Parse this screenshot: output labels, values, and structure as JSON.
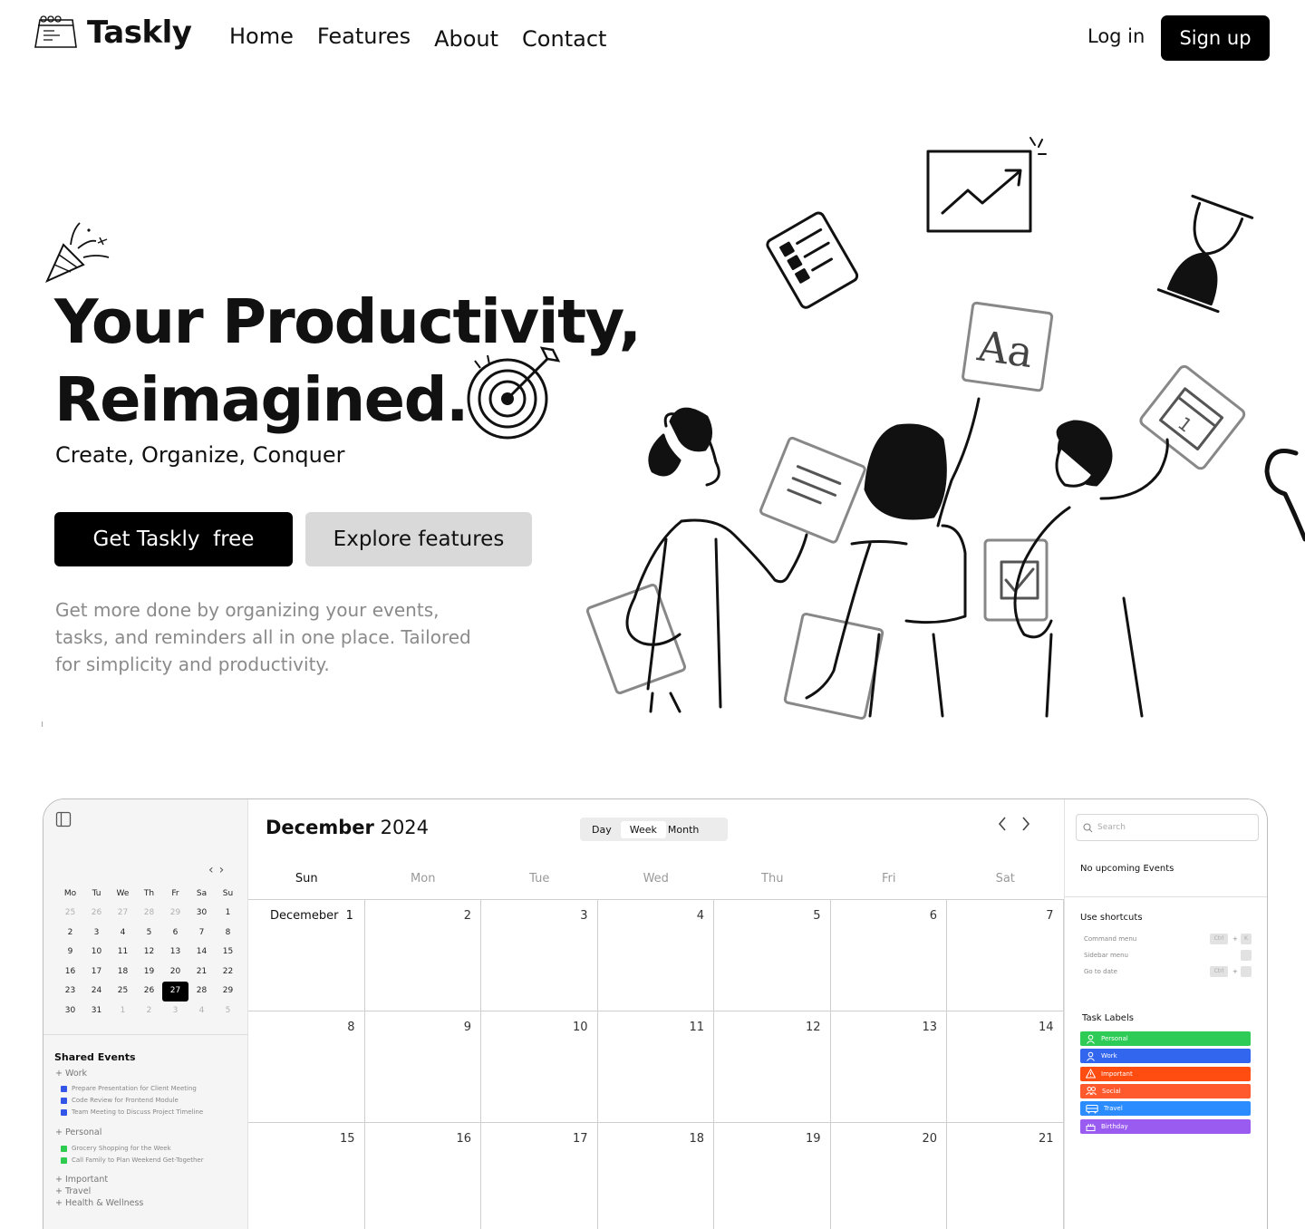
{
  "nav": {
    "brand": "Taskly",
    "links": [
      "Home",
      "Features",
      "About",
      "Contact"
    ],
    "login": "Log in",
    "signup": "Sign up"
  },
  "hero": {
    "title_line1": "Your Productivity,",
    "title_line2": "Reimagined.",
    "subtitle": "Create, Organize, Conquer",
    "primary_cta": "Get Taskly  free",
    "secondary_cta": "Explore features",
    "description": "Get more done by organizing your events, tasks, and reminders all in one place. Tailored for simplicity and productivity."
  },
  "illustration": {
    "card_text": "Aa",
    "calendar_day": "1"
  },
  "preview": {
    "mini_calendar": {
      "nav_prev": "‹",
      "nav_next": "›",
      "headers": [
        "Mo",
        "Tu",
        "We",
        "Th",
        "Fr",
        "Sa",
        "Su"
      ],
      "weeks": [
        [
          "25",
          "26",
          "27",
          "28",
          "29",
          "30",
          "1"
        ],
        [
          "2",
          "3",
          "4",
          "5",
          "6",
          "7",
          "8"
        ],
        [
          "9",
          "10",
          "11",
          "12",
          "13",
          "14",
          "15"
        ],
        [
          "16",
          "17",
          "18",
          "19",
          "20",
          "21",
          "22"
        ],
        [
          "23",
          "24",
          "25",
          "26",
          "27",
          "28",
          "29"
        ],
        [
          "30",
          "31",
          "1",
          "2",
          "3",
          "4",
          "5"
        ]
      ],
      "selected": "27"
    },
    "shared_events": {
      "title": "Shared Events",
      "work_group": "+ Work",
      "work_items": [
        "Prepare Presentation for Client Meeting",
        "Code Review for Frontend Module",
        "Team Meeting to Discuss Project Timeline"
      ],
      "personal_group": "+ Personal",
      "personal_items": [
        "Grocery Shopping for the Week",
        "Call Family to Plan Weekend Get-Together"
      ],
      "other_groups": [
        "+ Important",
        "+ Travel",
        "+ Health & Wellness"
      ],
      "colors": {
        "work": "#3356e8",
        "personal": "#2ecc4e"
      }
    },
    "calendar": {
      "month": "December",
      "year": "2024",
      "views": [
        "Day",
        "Week",
        "Month"
      ],
      "active_view": "Week",
      "weekdays": [
        "Sun",
        "Mon",
        "Tue",
        "Wed",
        "Thu",
        "Fri",
        "Sat"
      ],
      "rows": [
        [
          "Decemeber  1",
          "2",
          "3",
          "4",
          "5",
          "6",
          "7"
        ],
        [
          "8",
          "9",
          "10",
          "11",
          "12",
          "13",
          "14"
        ],
        [
          "15",
          "16",
          "17",
          "18",
          "19",
          "20",
          "21"
        ]
      ]
    },
    "right": {
      "search_placeholder": "Search",
      "no_events": "No upcoming Events",
      "shortcuts_title": "Use shortcuts",
      "shortcuts": [
        {
          "label": "Command menu",
          "keys": [
            "Ctrl",
            "+",
            "K"
          ]
        },
        {
          "label": "Sidebar menu",
          "keys": [
            ""
          ]
        },
        {
          "label": "Go to date",
          "keys": [
            "Ctrl",
            "+",
            ""
          ]
        }
      ],
      "labels_title": "Task Labels",
      "labels": [
        {
          "name": "Personal",
          "color": "#2ecc56",
          "icon": "user-icon"
        },
        {
          "name": "Work",
          "color": "#3366ee",
          "icon": "user-icon"
        },
        {
          "name": "Important",
          "color": "#ff4d12",
          "icon": "warning-icon"
        },
        {
          "name": "Social",
          "color": "#ff5a2e",
          "icon": "users-icon"
        },
        {
          "name": "Travel",
          "color": "#2b8cff",
          "icon": "bus-icon"
        },
        {
          "name": "Birthday",
          "color": "#9a5bf0",
          "icon": "cake-icon"
        }
      ]
    }
  }
}
